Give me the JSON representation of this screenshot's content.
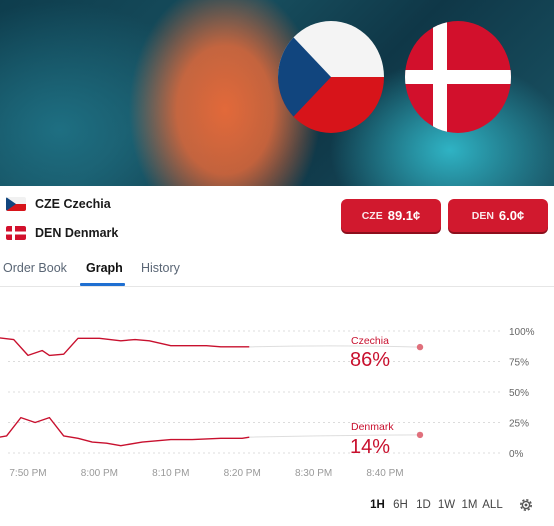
{
  "market": {
    "outcomes": [
      {
        "code": "CZE",
        "name": "Czechia",
        "label": "CZE Czechia",
        "button_code": "CZE",
        "button_price": "89.1¢",
        "chance": "86%",
        "chance_value": 86,
        "color": "#c8102e",
        "series_time": [
          "7:45",
          "7:48",
          "7:50",
          "7:52",
          "7:53",
          "7:55",
          "7:57",
          "8:00",
          "8:03",
          "8:05",
          "8:07",
          "8:10",
          "8:13",
          "8:15",
          "8:17",
          "8:20",
          "8:21"
        ],
        "series_value": [
          95,
          93,
          80,
          84,
          80,
          81,
          94,
          94,
          92,
          93,
          92,
          88,
          88,
          88,
          87,
          87,
          87
        ]
      },
      {
        "code": "DEN",
        "name": "Denmark",
        "label": "DEN Denmark",
        "button_code": "DEN",
        "button_price": "6.0¢",
        "chance": "14%",
        "chance_value": 14,
        "color": "#c8102e",
        "series_time": [
          "7:45",
          "7:47",
          "7:49",
          "7:51",
          "7:53",
          "7:55",
          "7:57",
          "7:59",
          "8:01",
          "8:03",
          "8:06",
          "8:10",
          "8:13",
          "8:17",
          "8:20",
          "8:21"
        ],
        "series_value": [
          12,
          14,
          29,
          25,
          29,
          14,
          12,
          9,
          8,
          6,
          9,
          11,
          11,
          12,
          12,
          13
        ]
      }
    ]
  },
  "tabs": {
    "order_book": "Order Book",
    "graph": "Graph",
    "history": "History"
  },
  "chart_data": {
    "type": "line",
    "x_ticks": [
      "7:50 PM",
      "8:00 PM",
      "8:10 PM",
      "8:20 PM",
      "8:30 PM",
      "8:40 PM"
    ],
    "y_ticks": [
      "100%",
      "75%",
      "50%",
      "25%",
      "0%"
    ],
    "ylim": [
      0,
      100
    ],
    "series": [
      {
        "name": "Czechia",
        "value_label": "86%"
      },
      {
        "name": "Denmark",
        "value_label": "14%"
      }
    ],
    "grid": true
  },
  "range_buttons": [
    "1H",
    "6H",
    "1D",
    "1W",
    "1M",
    "ALL"
  ],
  "active_range": "1H",
  "icons": {
    "settings": "gear-icon"
  }
}
